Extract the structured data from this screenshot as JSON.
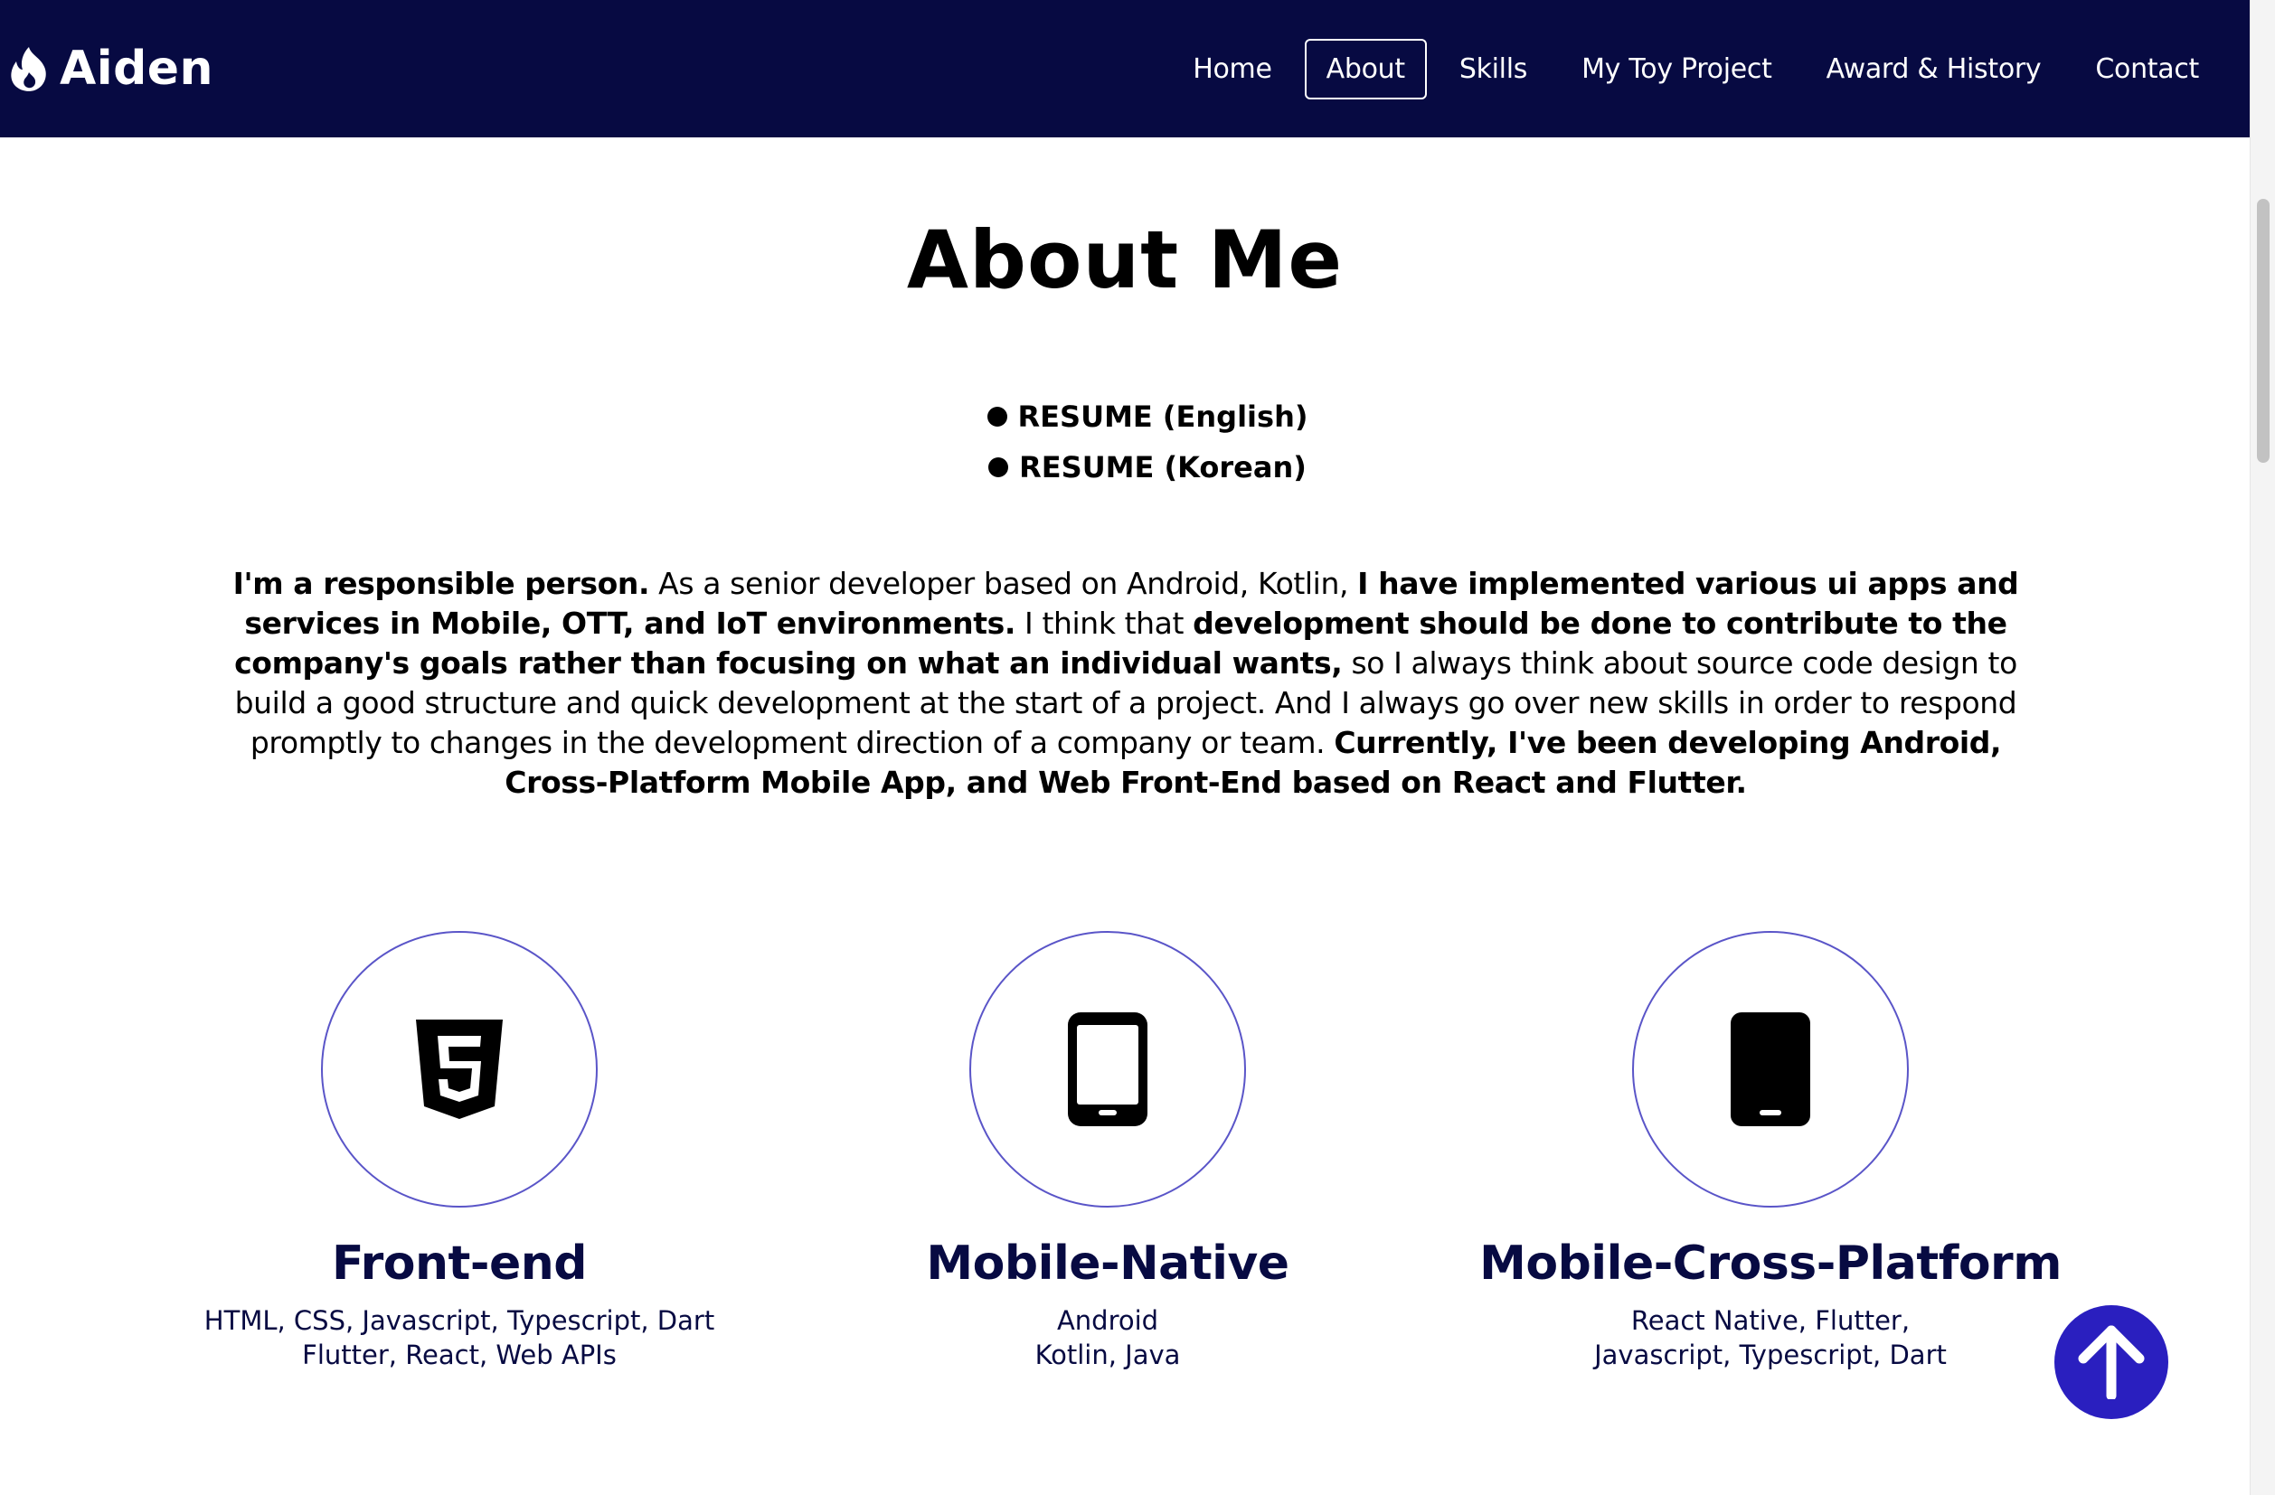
{
  "brand": {
    "name": "Aiden",
    "icon": "fire-icon"
  },
  "nav": {
    "items": [
      {
        "label": "Home",
        "active": false
      },
      {
        "label": "About",
        "active": true
      },
      {
        "label": "Skills",
        "active": false
      },
      {
        "label": "My Toy Project",
        "active": false
      },
      {
        "label": "Award & History",
        "active": false
      },
      {
        "label": "Contact",
        "active": false
      }
    ]
  },
  "about": {
    "title": "About Me",
    "resume_links": [
      {
        "label": "RESUME (English)"
      },
      {
        "label": "RESUME (Korean)"
      }
    ],
    "intro_parts": [
      {
        "text": "I'm a responsible person.",
        "bold": true
      },
      {
        "text": " As a senior developer based on Android, Kotlin, ",
        "bold": false
      },
      {
        "text": "I have implemented various ui apps and services in Mobile, OTT, and IoT environments.",
        "bold": true
      },
      {
        "text": " I think that ",
        "bold": false
      },
      {
        "text": "development should be done to contribute to the company's goals rather than focusing on what an individual wants,",
        "bold": true
      },
      {
        "text": " so I always think about source code design to build a good structure and quick development at the start of a project. And I always go over new skills in order to respond promptly to changes in the development direction of a company or team. ",
        "bold": false
      },
      {
        "text": "Currently, I've been developing Android, Cross-Platform Mobile App, and Web Front-End based on React and Flutter.",
        "bold": true
      }
    ]
  },
  "skills": [
    {
      "icon": "html5-icon",
      "title": "Front-end",
      "line1": "HTML, CSS, Javascript, Typescript, Dart",
      "line2": "Flutter, React, Web APIs"
    },
    {
      "icon": "mobile-outline-icon",
      "title": "Mobile-Native",
      "line1": "Android",
      "line2": "Kotlin, Java"
    },
    {
      "icon": "mobile-solid-icon",
      "title": "Mobile-Cross-Platform",
      "line1": "React Native, Flutter,",
      "line2": "Javascript, Typescript, Dart"
    }
  ],
  "colors": {
    "navbar_bg": "#070a42",
    "accent": "#2a1fbf",
    "circle_border": "#5a55c8",
    "card_text": "#070a42"
  },
  "back_to_top": {
    "icon": "arrow-up-icon"
  }
}
